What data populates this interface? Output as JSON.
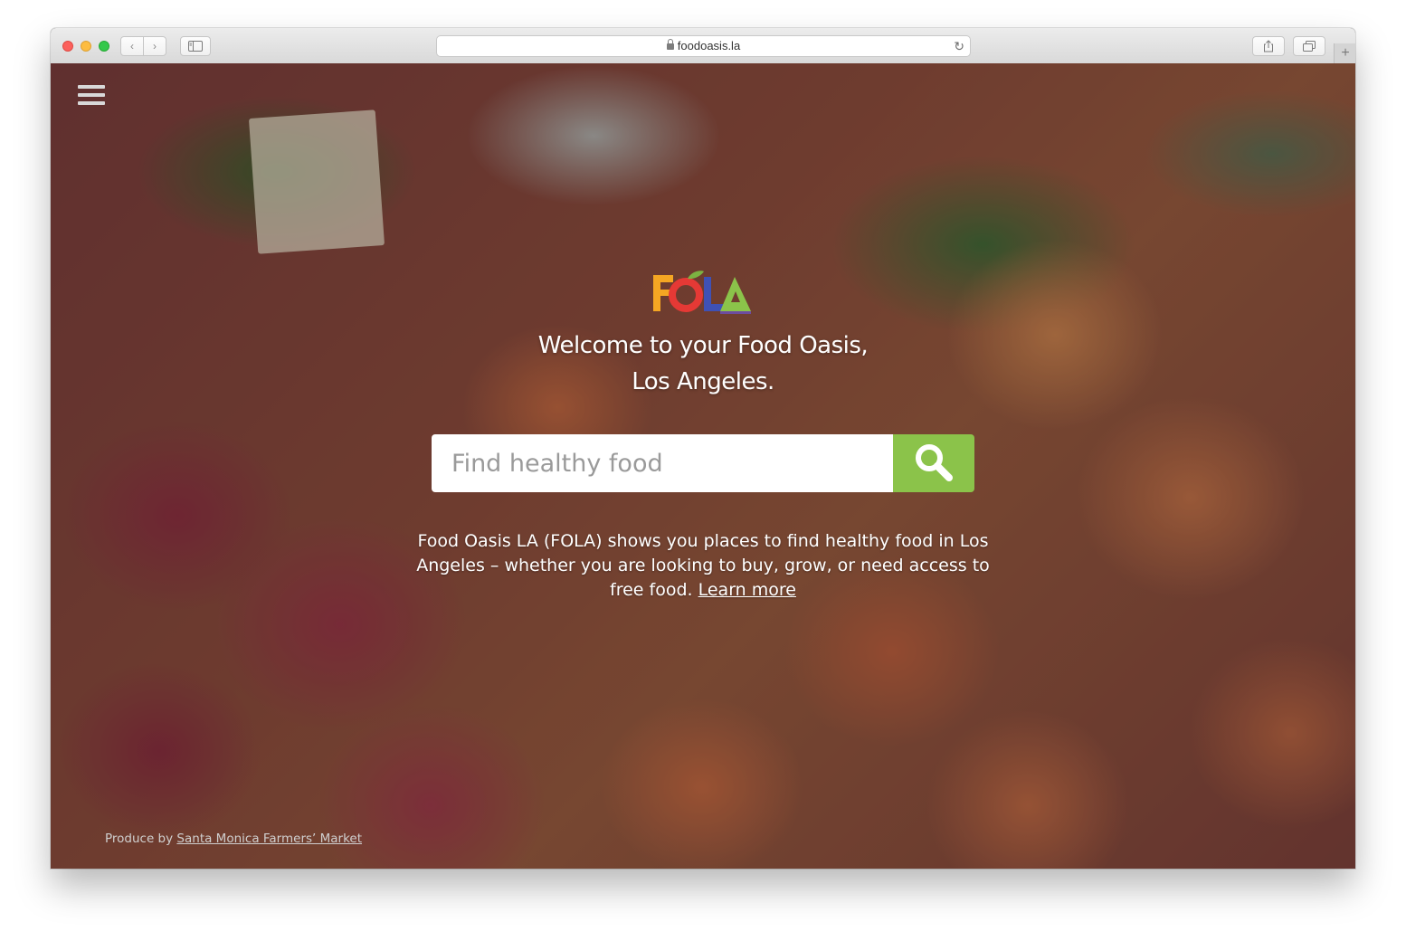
{
  "browser": {
    "url": "foodoasis.la",
    "buttons": {
      "back": "‹",
      "forward": "›",
      "new_tab": "+"
    }
  },
  "page": {
    "headline_line1": "Welcome to your Food Oasis,",
    "headline_line2": "Los Angeles.",
    "search": {
      "placeholder": "Find healthy food",
      "value": ""
    },
    "description_text": "Food Oasis LA (FOLA) shows you places to find healthy food in Los Angeles – whether you are looking to buy, grow, or need access to free food.",
    "learn_more": "Learn more",
    "credit_prefix": "Produce by",
    "credit_link": "Santa Monica Farmers’ Market"
  },
  "colors": {
    "accent": "#8bc34a",
    "logo_f": "#f5a623",
    "logo_o": "#e53935",
    "logo_leaf": "#7cb342",
    "logo_l": "#3f51b5",
    "logo_a": "#8bc34a"
  },
  "icons": {
    "menu": "hamburger-icon",
    "search": "magnifier-icon",
    "lock": "lock-icon",
    "reload": "reload-icon",
    "share": "share-icon",
    "tabs": "tabs-icon",
    "sidebar": "sidebar-icon"
  }
}
